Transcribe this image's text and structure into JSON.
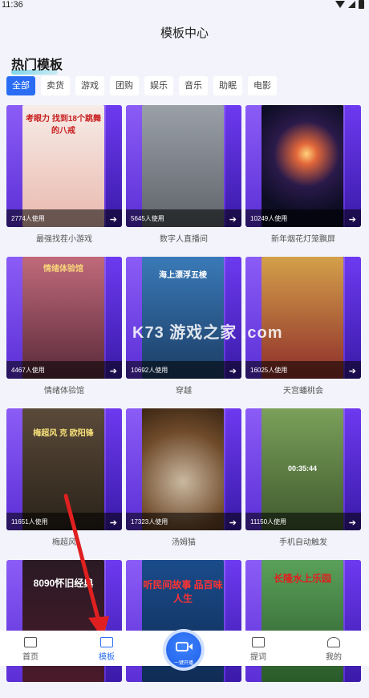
{
  "status": {
    "time": "11:36"
  },
  "page": {
    "title": "模板中心"
  },
  "section": {
    "title": "热门模板"
  },
  "filters": [
    {
      "label": "全部",
      "active": true
    },
    {
      "label": "卖货"
    },
    {
      "label": "游戏"
    },
    {
      "label": "团购"
    },
    {
      "label": "娱乐"
    },
    {
      "label": "音乐"
    },
    {
      "label": "助眠"
    },
    {
      "label": "电影"
    }
  ],
  "cards": [
    {
      "title": "最强找茬小游戏",
      "usage": "2774人使用",
      "poster": "考眼力 找到18个跳舞的八戒",
      "bg": "#f1d9d4"
    },
    {
      "title": "数字人直播间",
      "usage": "5645人使用",
      "poster": "",
      "bg": "#7d7f86"
    },
    {
      "title": "新年烟花灯笼飘屏",
      "usage": "10249人使用",
      "poster": "",
      "bg": "#12122e"
    },
    {
      "title": "情绪体验馆",
      "usage": "4467人使用",
      "poster": "情绪体验馆",
      "bg": "#8e3d4f"
    },
    {
      "title": "穿越",
      "usage": "10692人使用",
      "poster": "海上漂浮五棱",
      "bg": "#2d5b89"
    },
    {
      "title": "天宫蟠桃会",
      "usage": "16025人使用",
      "poster": "",
      "bg": "#b34a3c"
    },
    {
      "title": "梅超风",
      "usage": "11651人使用",
      "poster": "梅超风 克 欧阳锋",
      "bg": "#4a3c2c"
    },
    {
      "title": "汤姆猫",
      "usage": "17323人使用",
      "poster": "",
      "bg": "#6f4a2a"
    },
    {
      "title": "手机自动触发",
      "usage": "11150人使用",
      "poster": "00:35:44",
      "bg": "#4f6a3f"
    },
    {
      "title": "",
      "usage": "",
      "poster": "8090怀旧经典",
      "bg": "#2a1a24"
    },
    {
      "title": "",
      "usage": "",
      "poster": "听民间故事 品百味人生",
      "bg": "#1a4b8a"
    },
    {
      "title": "",
      "usage": "",
      "poster": "长隆水上乐园",
      "bg": "#3b7a3a"
    }
  ],
  "watermark": "K73 游戏之家 .com",
  "nav": {
    "home": "首页",
    "template": "模板",
    "fab": "一键开播",
    "prompt": "提词",
    "me": "我的"
  },
  "colors": {
    "accent": "#2a6df4",
    "card_purple": "#6d3af0",
    "arrow_red": "#e02020"
  }
}
